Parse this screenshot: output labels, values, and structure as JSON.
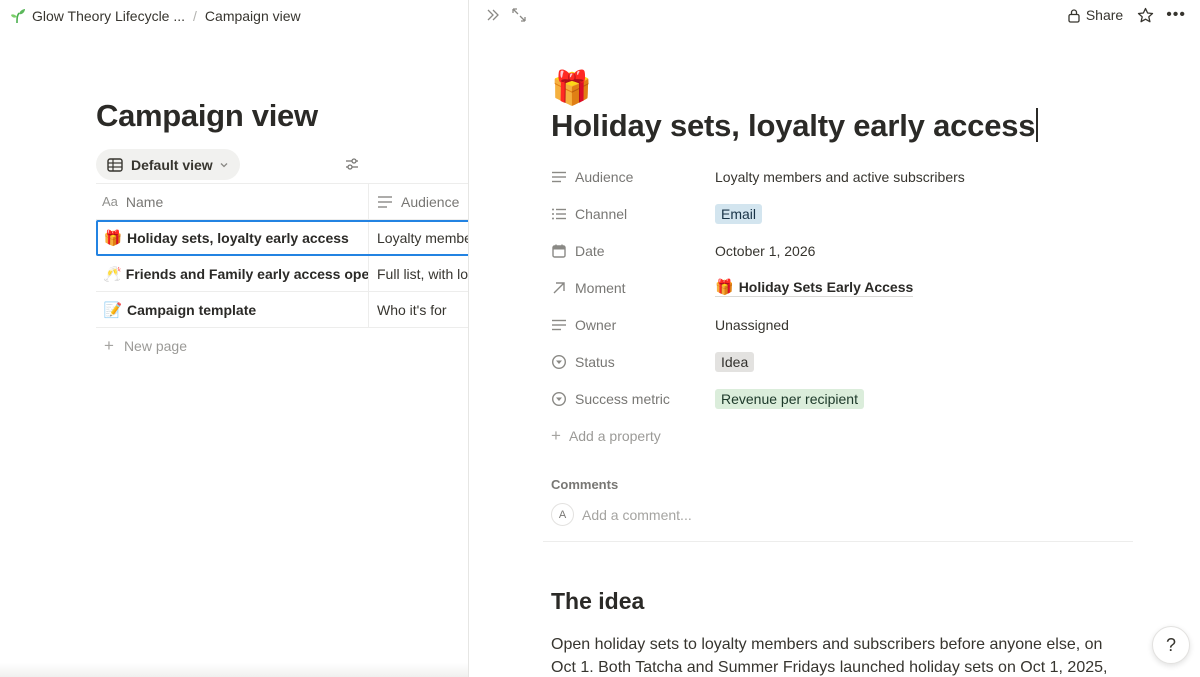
{
  "breadcrumb": {
    "workspace": "Glow Theory Lifecycle ...",
    "separator": "/",
    "page": "Campaign view"
  },
  "left": {
    "title": "Campaign view",
    "view_label": "Default view",
    "columns": {
      "name": "Name",
      "name_prefix": "Aa",
      "audience": "Audience"
    },
    "rows": [
      {
        "icon": "🎁",
        "name": "Holiday sets, loyalty early access",
        "audience": "Loyalty members and active subscribers",
        "audience_visible": "Loyalty membe"
      },
      {
        "icon": "🥂",
        "name": "Friends and Family early access opens",
        "audience": "Full list, with lo",
        "audience_visible": "Full list, with lo"
      },
      {
        "icon": "📝",
        "name": "Campaign template",
        "audience": "Who it's for",
        "audience_visible": "Who it's for"
      }
    ],
    "new_page": "New page"
  },
  "right": {
    "share": "Share",
    "page_icon": "🎁",
    "title": "Holiday sets, loyalty early access",
    "properties": {
      "audience": {
        "label": "Audience",
        "value": "Loyalty members and active subscribers"
      },
      "channel": {
        "label": "Channel",
        "value": "Email"
      },
      "date": {
        "label": "Date",
        "value": "October 1, 2026"
      },
      "moment": {
        "label": "Moment",
        "icon": "🎁",
        "value": "Holiday Sets Early Access"
      },
      "owner": {
        "label": "Owner",
        "value": "Unassigned"
      },
      "status": {
        "label": "Status",
        "value": "Idea"
      },
      "success_metric": {
        "label": "Success metric",
        "value": "Revenue per recipient"
      }
    },
    "add_property": "Add a property",
    "comments_label": "Comments",
    "comment_avatar": "A",
    "comment_placeholder": "Add a comment...",
    "heading": "The idea",
    "body": "Open holiday sets to loyalty members and subscribers before anyone else, on Oct 1. Both Tatcha and Summer Fridays launched holiday sets on Oct 1, 2025,"
  },
  "colors": {
    "accent_blue": "#2383e2",
    "tag_blue": "#d3e5ef",
    "tag_gray": "#e3e2e0",
    "tag_green": "#dbeddb",
    "sprout_green": "#4caf50"
  },
  "icons": [
    "sprout-icon",
    "table-icon",
    "chevron-down-icon",
    "filter-sliders-icon",
    "text-lines-icon",
    "list-icon",
    "calendar-icon",
    "arrow-up-right-icon",
    "status-circle-icon",
    "lock-icon",
    "star-icon",
    "more-icon",
    "expand-icon",
    "collapse-icon",
    "help-icon"
  ]
}
